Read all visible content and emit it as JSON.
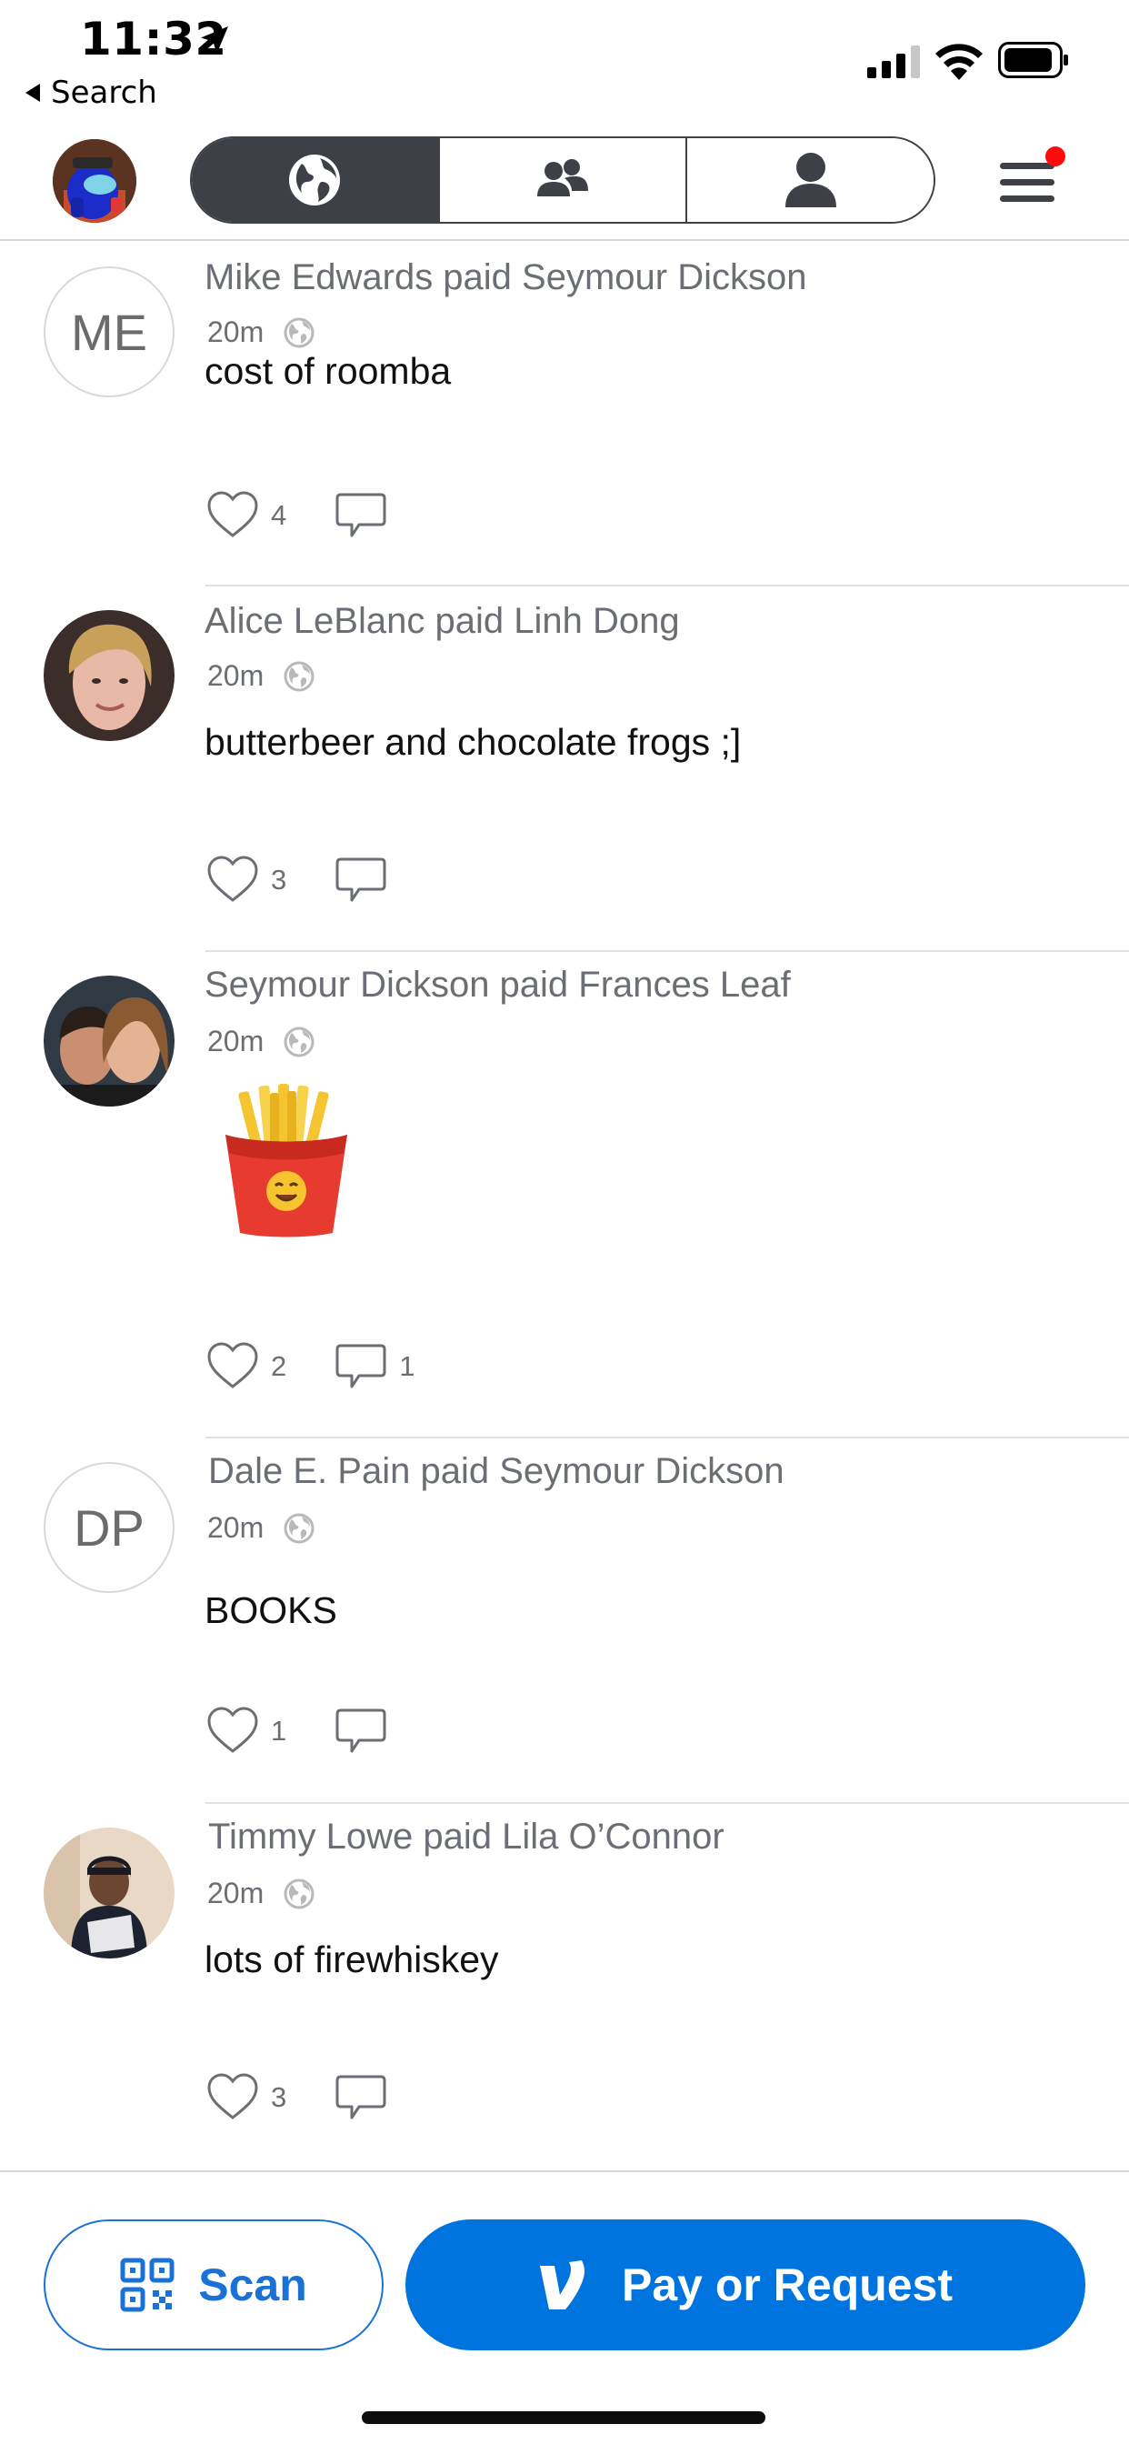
{
  "status_bar": {
    "time": "11:32",
    "back_label": "Search",
    "icons": [
      "location-arrow-icon",
      "signal-icon",
      "wifi-icon",
      "battery-icon"
    ]
  },
  "nav": {
    "tabs": [
      {
        "icon": "globe-icon",
        "active": true
      },
      {
        "icon": "friends-icon",
        "active": false
      },
      {
        "icon": "person-icon",
        "active": false
      }
    ],
    "menu_icon": "hamburger-menu-icon",
    "notification_color": "#ff0b0b"
  },
  "feed": [
    {
      "avatar_initials": "ME",
      "headline": "Mike Edwards paid Seymour Dickson",
      "time": "20m",
      "note": "cost of roomba",
      "likes": "4",
      "comments": ""
    },
    {
      "avatar_initials": "",
      "headline": "Alice LeBlanc paid Linh Dong",
      "time": "20m",
      "note": "butterbeer and chocolate frogs ;]",
      "likes": "3",
      "comments": ""
    },
    {
      "avatar_initials": "",
      "headline": "Seymour Dickson paid Frances Leaf",
      "time": "20m",
      "note": "",
      "note_icon": "french-fries-emoji-icon",
      "likes": "2",
      "comments": "1"
    },
    {
      "avatar_initials": "DP",
      "headline": "Dale E. Pain paid Seymour Dickson",
      "time": "20m",
      "note": "BOOKS",
      "likes": "1",
      "comments": ""
    },
    {
      "avatar_initials": "",
      "headline": "Timmy Lowe paid Lila O’Connor",
      "time": "20m",
      "note": "lots of firewhiskey",
      "likes": "3",
      "comments": ""
    }
  ],
  "bottom": {
    "scan_label": "Scan",
    "pay_label": "Pay or Request",
    "brand_color": "#0074de"
  }
}
